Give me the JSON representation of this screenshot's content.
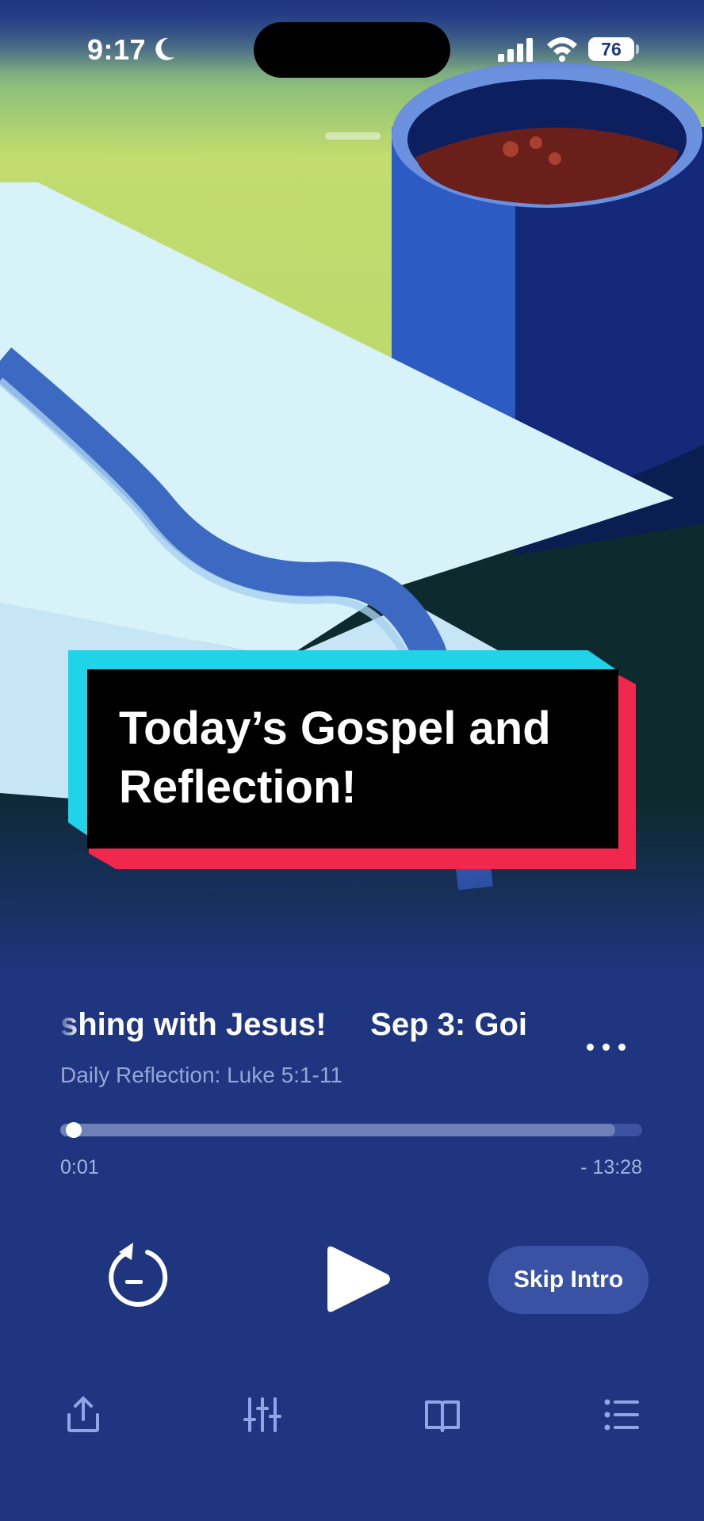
{
  "status_bar": {
    "time": "9:17",
    "battery": "76"
  },
  "caption": {
    "text": "Today’s Gospel and Reflection!"
  },
  "player": {
    "track_title": "shing with Jesus!     Sep 3: Goi",
    "subtitle": "Daily Reflection: Luke 5:1-11",
    "elapsed": "0:01",
    "remaining": "- 13:28",
    "progress_fraction": 0.01,
    "skip_intro_label": "Skip Intro"
  },
  "toolbar": {
    "icons": [
      "share-icon",
      "equalizer-icon",
      "book-icon",
      "list-icon"
    ]
  },
  "colors": {
    "background": "#1f3580",
    "accent_cyan": "#20d3e9",
    "accent_red": "#f0284e",
    "artwork_green": "#c2dc6e",
    "text_muted": "#94a6d8"
  }
}
